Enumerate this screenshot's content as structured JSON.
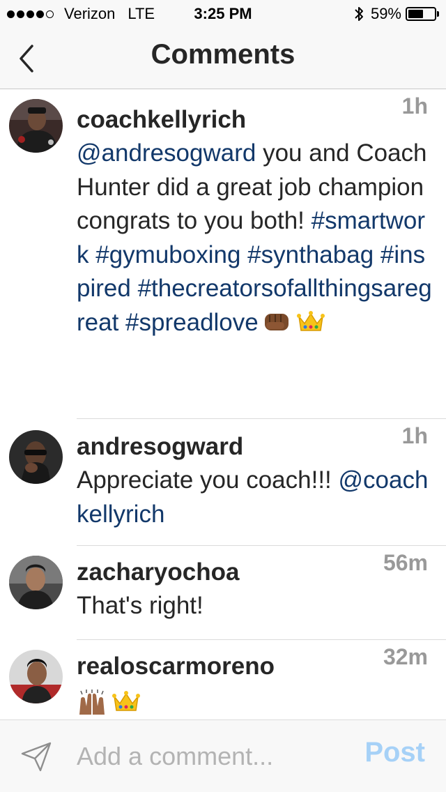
{
  "status_bar": {
    "carrier": "Verizon",
    "network": "LTE",
    "time": "3:25 PM",
    "battery": "59%",
    "battery_level": 0.59,
    "signal_bars": 4,
    "signal_total": 5
  },
  "nav": {
    "back_icon": "chevron-left-icon",
    "title": "Comments"
  },
  "comments": [
    {
      "username": "coachkellyrich",
      "time": "1h",
      "parts": [
        {
          "t": "@andresogward",
          "link": true
        },
        {
          "t": " you and CoachHunter did a great job champion congrats to you both! ",
          "link": false
        },
        {
          "t": "#smartwork",
          "link": true
        },
        {
          "t": " ",
          "link": false
        },
        {
          "t": "#gymuboxing",
          "link": true
        },
        {
          "t": " ",
          "link": false
        },
        {
          "t": "#synthabag",
          "link": true
        },
        {
          "t": " ",
          "link": false
        },
        {
          "t": "#inspired",
          "link": true
        },
        {
          "t": " ",
          "link": false
        },
        {
          "t": "#thecreatorsofallthingsaregreat",
          "link": true
        },
        {
          "t": " ",
          "link": false
        },
        {
          "t": "#spreadlove",
          "link": true
        }
      ],
      "emojis": [
        "fist-emoji",
        "crown-emoji"
      ]
    },
    {
      "username": "andresogward",
      "time": "1h",
      "parts": [
        {
          "t": "Appreciate you coach!!! ",
          "link": false
        },
        {
          "t": "@coachkellyrich",
          "link": true
        }
      ],
      "emojis": []
    },
    {
      "username": "zacharyochoa",
      "time": "56m",
      "parts": [
        {
          "t": "That's right!",
          "link": false
        }
      ],
      "emojis": []
    },
    {
      "username": "realoscarmoreno",
      "time": "32m",
      "parts": [],
      "emojis": [
        "raised-hands-emoji",
        "crown-emoji"
      ]
    }
  ],
  "composer": {
    "send_icon": "paper-plane-icon",
    "placeholder": "Add a comment...",
    "post_label": "Post"
  },
  "colors": {
    "link": "#12386a",
    "timestamp": "#999999",
    "post_disabled": "#a6d1f7",
    "text": "#262626"
  }
}
